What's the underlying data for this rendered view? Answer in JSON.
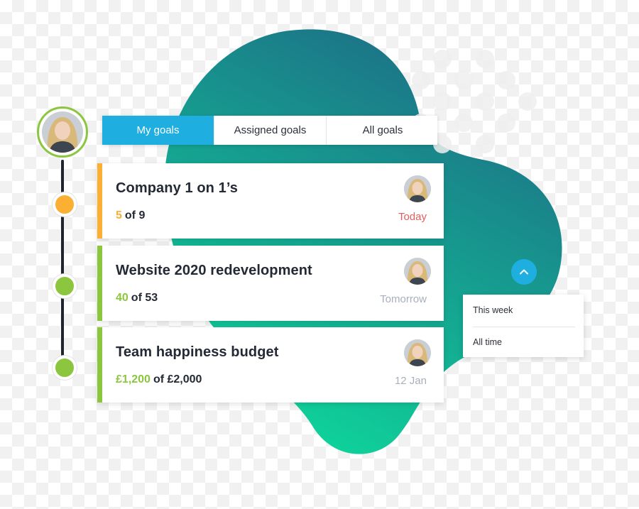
{
  "colors": {
    "accent_blue": "#1faee0",
    "green": "#8cc63f",
    "orange": "#fbb034",
    "due_today_red": "#e35d5d",
    "due_muted": "#a8b0bb",
    "blob_top": "#1d6e86",
    "blob_bottom": "#0ed39a"
  },
  "tabs": [
    {
      "label": "My goals",
      "active": true
    },
    {
      "label": "Assigned goals",
      "active": false
    },
    {
      "label": "All goals",
      "active": false
    }
  ],
  "goals": [
    {
      "title": "Company 1 on 1’s",
      "current": "5",
      "of_text": "of 9",
      "due": "Today",
      "accent": "#fbb034"
    },
    {
      "title": "Website 2020 redevelopment",
      "current": "40",
      "of_text": "of 53",
      "due": "Tomorrow",
      "accent": "#8cc63f"
    },
    {
      "title": "Team happiness budget",
      "current": "£1,200",
      "of_text": "of £2,000",
      "due": "12 Jan",
      "accent": "#8cc63f"
    }
  ],
  "timeline": {
    "nodes": [
      "#fbb034",
      "#8cc63f",
      "#8cc63f"
    ]
  },
  "scroll_button": {
    "icon": "chevron-up-icon"
  },
  "filter_menu": {
    "items": [
      "This week",
      "All time"
    ]
  }
}
